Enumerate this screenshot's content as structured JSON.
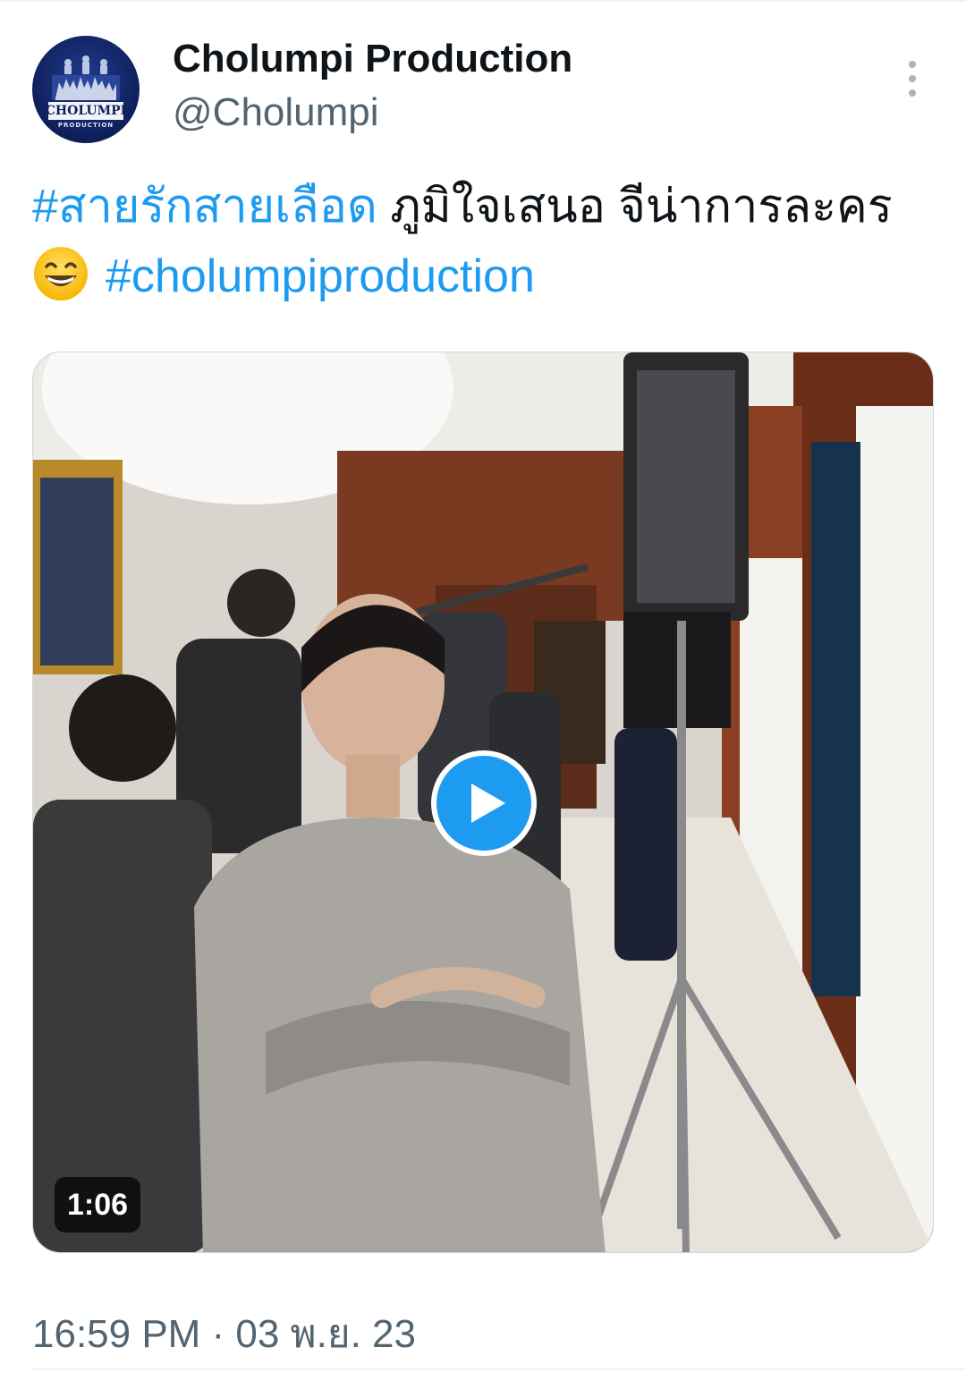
{
  "author": {
    "display_name": "Cholumpi Production",
    "handle": "@Cholumpi",
    "avatar_icon": "cholumpi-logo",
    "avatar_text_line1": "CHOLUMPI",
    "avatar_text_line2": "PRODUCTION"
  },
  "menu": {
    "icon": "more-vertical-icon"
  },
  "tweet": {
    "hashtag_1": "#สายรักสายเลือด",
    "text": " ภูมิใจเสนอ จีน่าการละคร",
    "emoji": "grinning-face-with-smiling-eyes",
    "hashtag_2": "#cholumpiproduction"
  },
  "media": {
    "type": "video",
    "duration": "1:06",
    "play_icon": "play-icon"
  },
  "meta": {
    "timestamp": "16:59 PM · 03 พ.ย. 23"
  },
  "colors": {
    "link": "#1d9bf0",
    "text": "#0f1419",
    "secondary": "#536471"
  }
}
